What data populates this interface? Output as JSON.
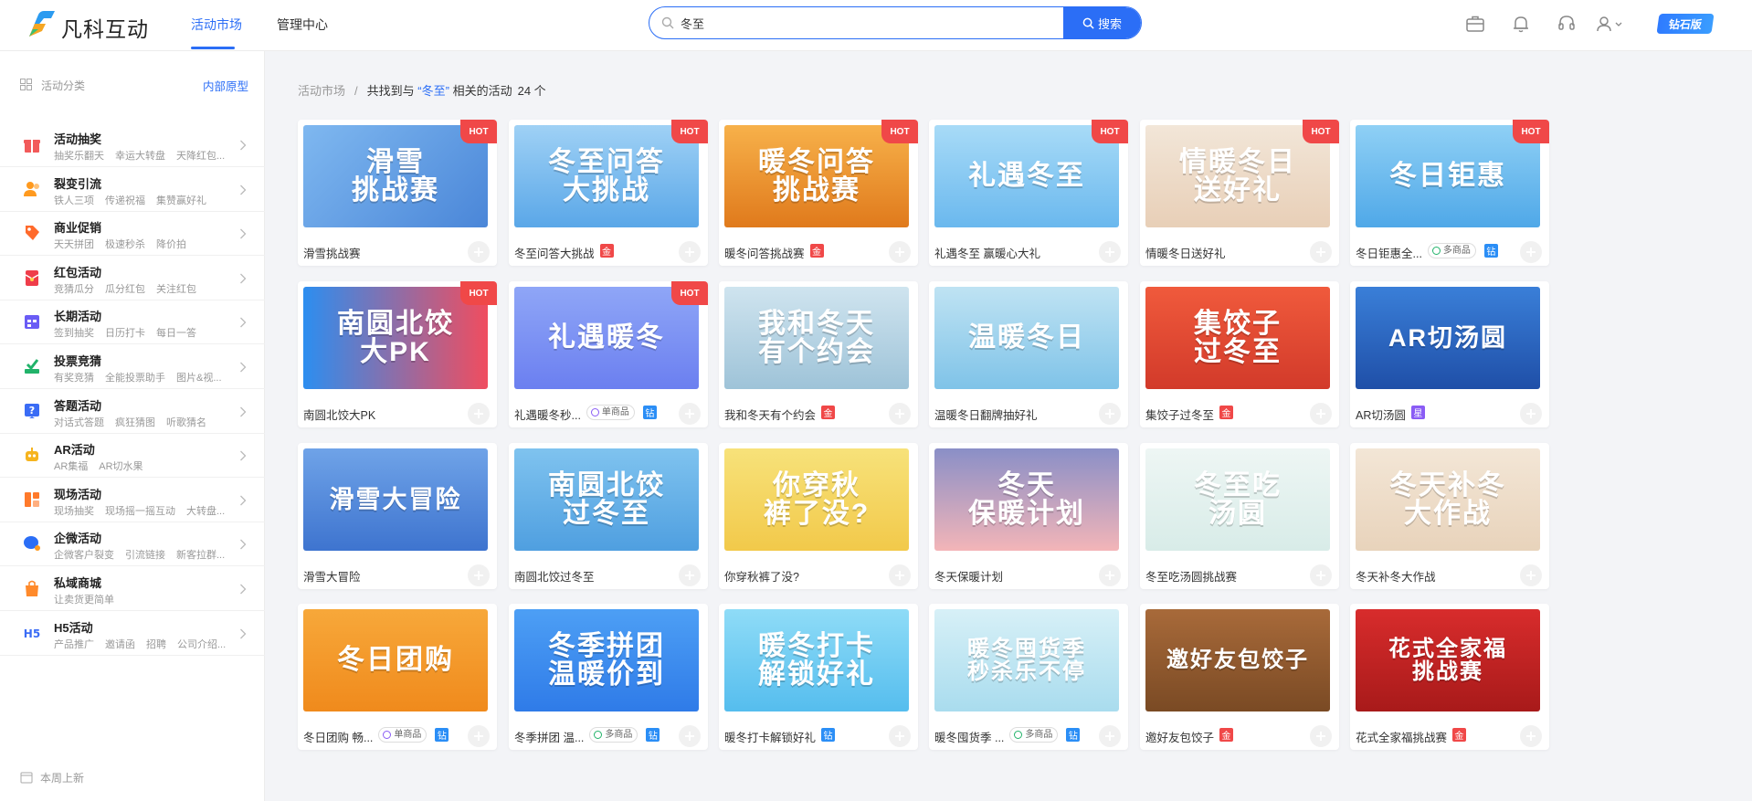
{
  "header": {
    "logo_text": "凡科互动",
    "nav": [
      {
        "label": "活动市场",
        "active": true
      },
      {
        "label": "管理中心",
        "active": false
      }
    ],
    "search": {
      "value": "冬至",
      "button_label": "搜索"
    },
    "icons": [
      "briefcase-icon",
      "bell-icon",
      "headset-icon",
      "user-icon"
    ],
    "vip_label": "钻石版"
  },
  "sidebar": {
    "title": "活动分类",
    "link": "内部原型",
    "categories": [
      {
        "title": "活动抽奖",
        "subs": [
          "抽奖乐翻天",
          "幸运大转盘",
          "天降红包..."
        ],
        "icon": "gift-icon",
        "color": "#f25a5a"
      },
      {
        "title": "裂变引流",
        "subs": [
          "铁人三项",
          "传递祝福",
          "集赞赢好礼"
        ],
        "icon": "users-icon",
        "color": "#ff9a1f"
      },
      {
        "title": "商业促销",
        "subs": [
          "天天拼团",
          "极速秒杀",
          "降价拍"
        ],
        "icon": "tag-icon",
        "color": "#ff6a2b"
      },
      {
        "title": "红包活动",
        "subs": [
          "竞猜瓜分",
          "瓜分红包",
          "关注红包"
        ],
        "icon": "red-envelope-icon",
        "color": "#ef3d4a"
      },
      {
        "title": "长期活动",
        "subs": [
          "签到抽奖",
          "日历打卡",
          "每日一答"
        ],
        "icon": "calendar-icon",
        "color": "#6a5cf5"
      },
      {
        "title": "投票竞猜",
        "subs": [
          "有奖竞猜",
          "全能投票助手",
          "图片&视..."
        ],
        "icon": "vote-icon",
        "color": "#21b36a"
      },
      {
        "title": "答题活动",
        "subs": [
          "对话式答题",
          "疯狂猜图",
          "听歌猜名"
        ],
        "icon": "question-icon",
        "color": "#3a6cf5"
      },
      {
        "title": "AR活动",
        "subs": [
          "AR集福",
          "AR切水果"
        ],
        "icon": "robot-icon",
        "color": "#f6b41f"
      },
      {
        "title": "现场活动",
        "subs": [
          "现场抽奖",
          "现场摇一摇互动",
          "大转盘..."
        ],
        "icon": "stage-icon",
        "color": "#ff7a2b"
      },
      {
        "title": "企微活动",
        "subs": [
          "企微客户裂变",
          "引流链接",
          "新客拉群..."
        ],
        "icon": "wecom-icon",
        "color": "#2b6ef6"
      },
      {
        "title": "私域商城",
        "subs": [
          "让卖货更简单"
        ],
        "icon": "bag-icon",
        "color": "#ff8a2b"
      },
      {
        "title": "H5活动",
        "subs": [
          "产品推广",
          "邀请函",
          "招聘",
          "公司介绍..."
        ],
        "icon": "h5-icon",
        "color": "#3a6cf5"
      }
    ],
    "footer": "本周上新"
  },
  "breadcrumb": {
    "root": "活动市场",
    "text_prefix": "共找到与",
    "keyword": "“冬至”",
    "text_suffix": "相关的活动",
    "count": "24 个"
  },
  "badges": {
    "gold": "金",
    "diamond": "钻",
    "star": "星"
  },
  "cards": [
    {
      "name": "滑雪挑战赛",
      "thumb": "滑雪\n挑战赛",
      "hot": true,
      "bg": "linear-gradient(135deg,#7fb8f0,#4a86d8)",
      "badge": null,
      "tag": null
    },
    {
      "name": "冬至问答大挑战",
      "thumb": "冬至问答\n大挑战",
      "hot": true,
      "bg": "linear-gradient(180deg,#9fd1f5,#5aa7e8)",
      "badge": "gold",
      "tag": null
    },
    {
      "name": "暖冬问答挑战赛",
      "thumb": "暖冬问答\n挑战赛",
      "hot": true,
      "bg": "linear-gradient(180deg,#f7b14a,#e07a1c)",
      "badge": "gold",
      "tag": null
    },
    {
      "name": "礼遇冬至 赢暖心大礼",
      "thumb": "礼遇冬至",
      "hot": true,
      "bg": "linear-gradient(180deg,#a8dbf7,#6ab8ee)",
      "badge": null,
      "tag": null
    },
    {
      "name": "情暖冬日送好礼",
      "thumb": "情暖冬日\n送好礼",
      "hot": true,
      "bg": "linear-gradient(180deg,#f2e6d8,#e8cfb7)",
      "badge": null,
      "tag": null
    },
    {
      "name": "冬日钜惠全...",
      "thumb": "冬日钜惠",
      "hot": true,
      "bg": "linear-gradient(180deg,#8fd0f5,#4fa8e8)",
      "badge": "diamond",
      "tag": "多商品"
    },
    {
      "name": "南圆北饺大PK",
      "thumb": "南圆北饺\n大PK",
      "hot": true,
      "bg": "linear-gradient(90deg,#2c8ef0,#f04d5f)",
      "badge": null,
      "tag": null
    },
    {
      "name": "礼遇暖冬秒...",
      "thumb": "礼遇暖冬",
      "hot": true,
      "bg": "linear-gradient(180deg,#8fa6f7,#6b7ff0)",
      "badge": "diamond",
      "tag": "单商品"
    },
    {
      "name": "我和冬天有个约会",
      "thumb": "我和冬天\n有个约会",
      "hot": false,
      "bg": "linear-gradient(180deg,#cfe4ef,#9ec3d8)",
      "badge": "gold",
      "tag": null
    },
    {
      "name": "温暖冬日翻牌抽好礼",
      "thumb": "温暖冬日",
      "hot": false,
      "bg": "linear-gradient(180deg,#bfe3f3,#7fc3e8)",
      "badge": null,
      "tag": null
    },
    {
      "name": "集饺子过冬至",
      "thumb": "集饺子\n过冬至",
      "hot": false,
      "bg": "linear-gradient(180deg,#f05a3c,#d23a2a)",
      "badge": "gold",
      "tag": null
    },
    {
      "name": "AR切汤圆",
      "thumb": "AR切汤圆",
      "hot": false,
      "bg": "linear-gradient(180deg,#3a7fd8,#1f4fa8)",
      "badge": "star",
      "tag": null
    },
    {
      "name": "滑雪大冒险",
      "thumb": "滑雪大冒险",
      "hot": false,
      "bg": "linear-gradient(180deg,#6fa3e8,#3e74cf)",
      "badge": null,
      "tag": null
    },
    {
      "name": "南圆北饺过冬至",
      "thumb": "南圆北饺\n过冬至",
      "hot": false,
      "bg": "linear-gradient(180deg,#7fc3ef,#4f9fe0)",
      "badge": null,
      "tag": null
    },
    {
      "name": "你穿秋裤了没?",
      "thumb": "你穿秋\n裤了没?",
      "hot": false,
      "bg": "linear-gradient(180deg,#f7e27a,#f2c94a)",
      "badge": null,
      "tag": null
    },
    {
      "name": "冬天保暖计划",
      "thumb": "冬天\n保暖计划",
      "hot": false,
      "bg": "linear-gradient(180deg,#8a8fc7,#f3b5b8)",
      "badge": null,
      "tag": null
    },
    {
      "name": "冬至吃汤圆挑战赛",
      "thumb": "冬至吃\n汤圆",
      "hot": false,
      "bg": "linear-gradient(180deg,#eef6f4,#d8ece8)",
      "badge": null,
      "tag": null
    },
    {
      "name": "冬天补冬大作战",
      "thumb": "冬天补冬\n大作战",
      "hot": false,
      "bg": "linear-gradient(180deg,#f3e6d6,#e8d3bb)",
      "badge": null,
      "tag": null
    },
    {
      "name": "冬日团购 畅...",
      "thumb": "冬日团购",
      "hot": false,
      "bg": "linear-gradient(180deg,#f7a83a,#f08a1c)",
      "badge": "diamond",
      "tag": "单商品"
    },
    {
      "name": "冬季拼团 温...",
      "thumb": "冬季拼团\n温暖价到",
      "hot": false,
      "bg": "linear-gradient(180deg,#4d9ff5,#2f7be8)",
      "badge": "diamond",
      "tag": "多商品"
    },
    {
      "name": "暖冬打卡解锁好礼",
      "thumb": "暖冬打卡\n解锁好礼",
      "hot": false,
      "bg": "linear-gradient(180deg,#8fdcf7,#55bdee)",
      "badge": "diamond",
      "tag": null
    },
    {
      "name": "暖冬囤货季 ...",
      "thumb": "暖冬囤货季\n秒杀乐不停",
      "hot": false,
      "bg": "linear-gradient(180deg,#d7f0f7,#a9dcee)",
      "badge": "diamond",
      "tag": "多商品"
    },
    {
      "name": "邀好友包饺子",
      "thumb": "邀好友包饺子",
      "hot": false,
      "bg": "linear-gradient(180deg,#a86a3a,#7a4a24)",
      "badge": "gold",
      "tag": null
    },
    {
      "name": "花式全家福挑战赛",
      "thumb": "花式全家福\n挑战赛",
      "hot": false,
      "bg": "linear-gradient(180deg,#d82c2c,#a81a1a)",
      "badge": "gold",
      "tag": null
    }
  ],
  "colors": {
    "accent": "#2b6ef6",
    "gold": "#f04848",
    "diamond": "#2b8ef6",
    "star": "#8a5cf5",
    "hot": "#f04848"
  }
}
